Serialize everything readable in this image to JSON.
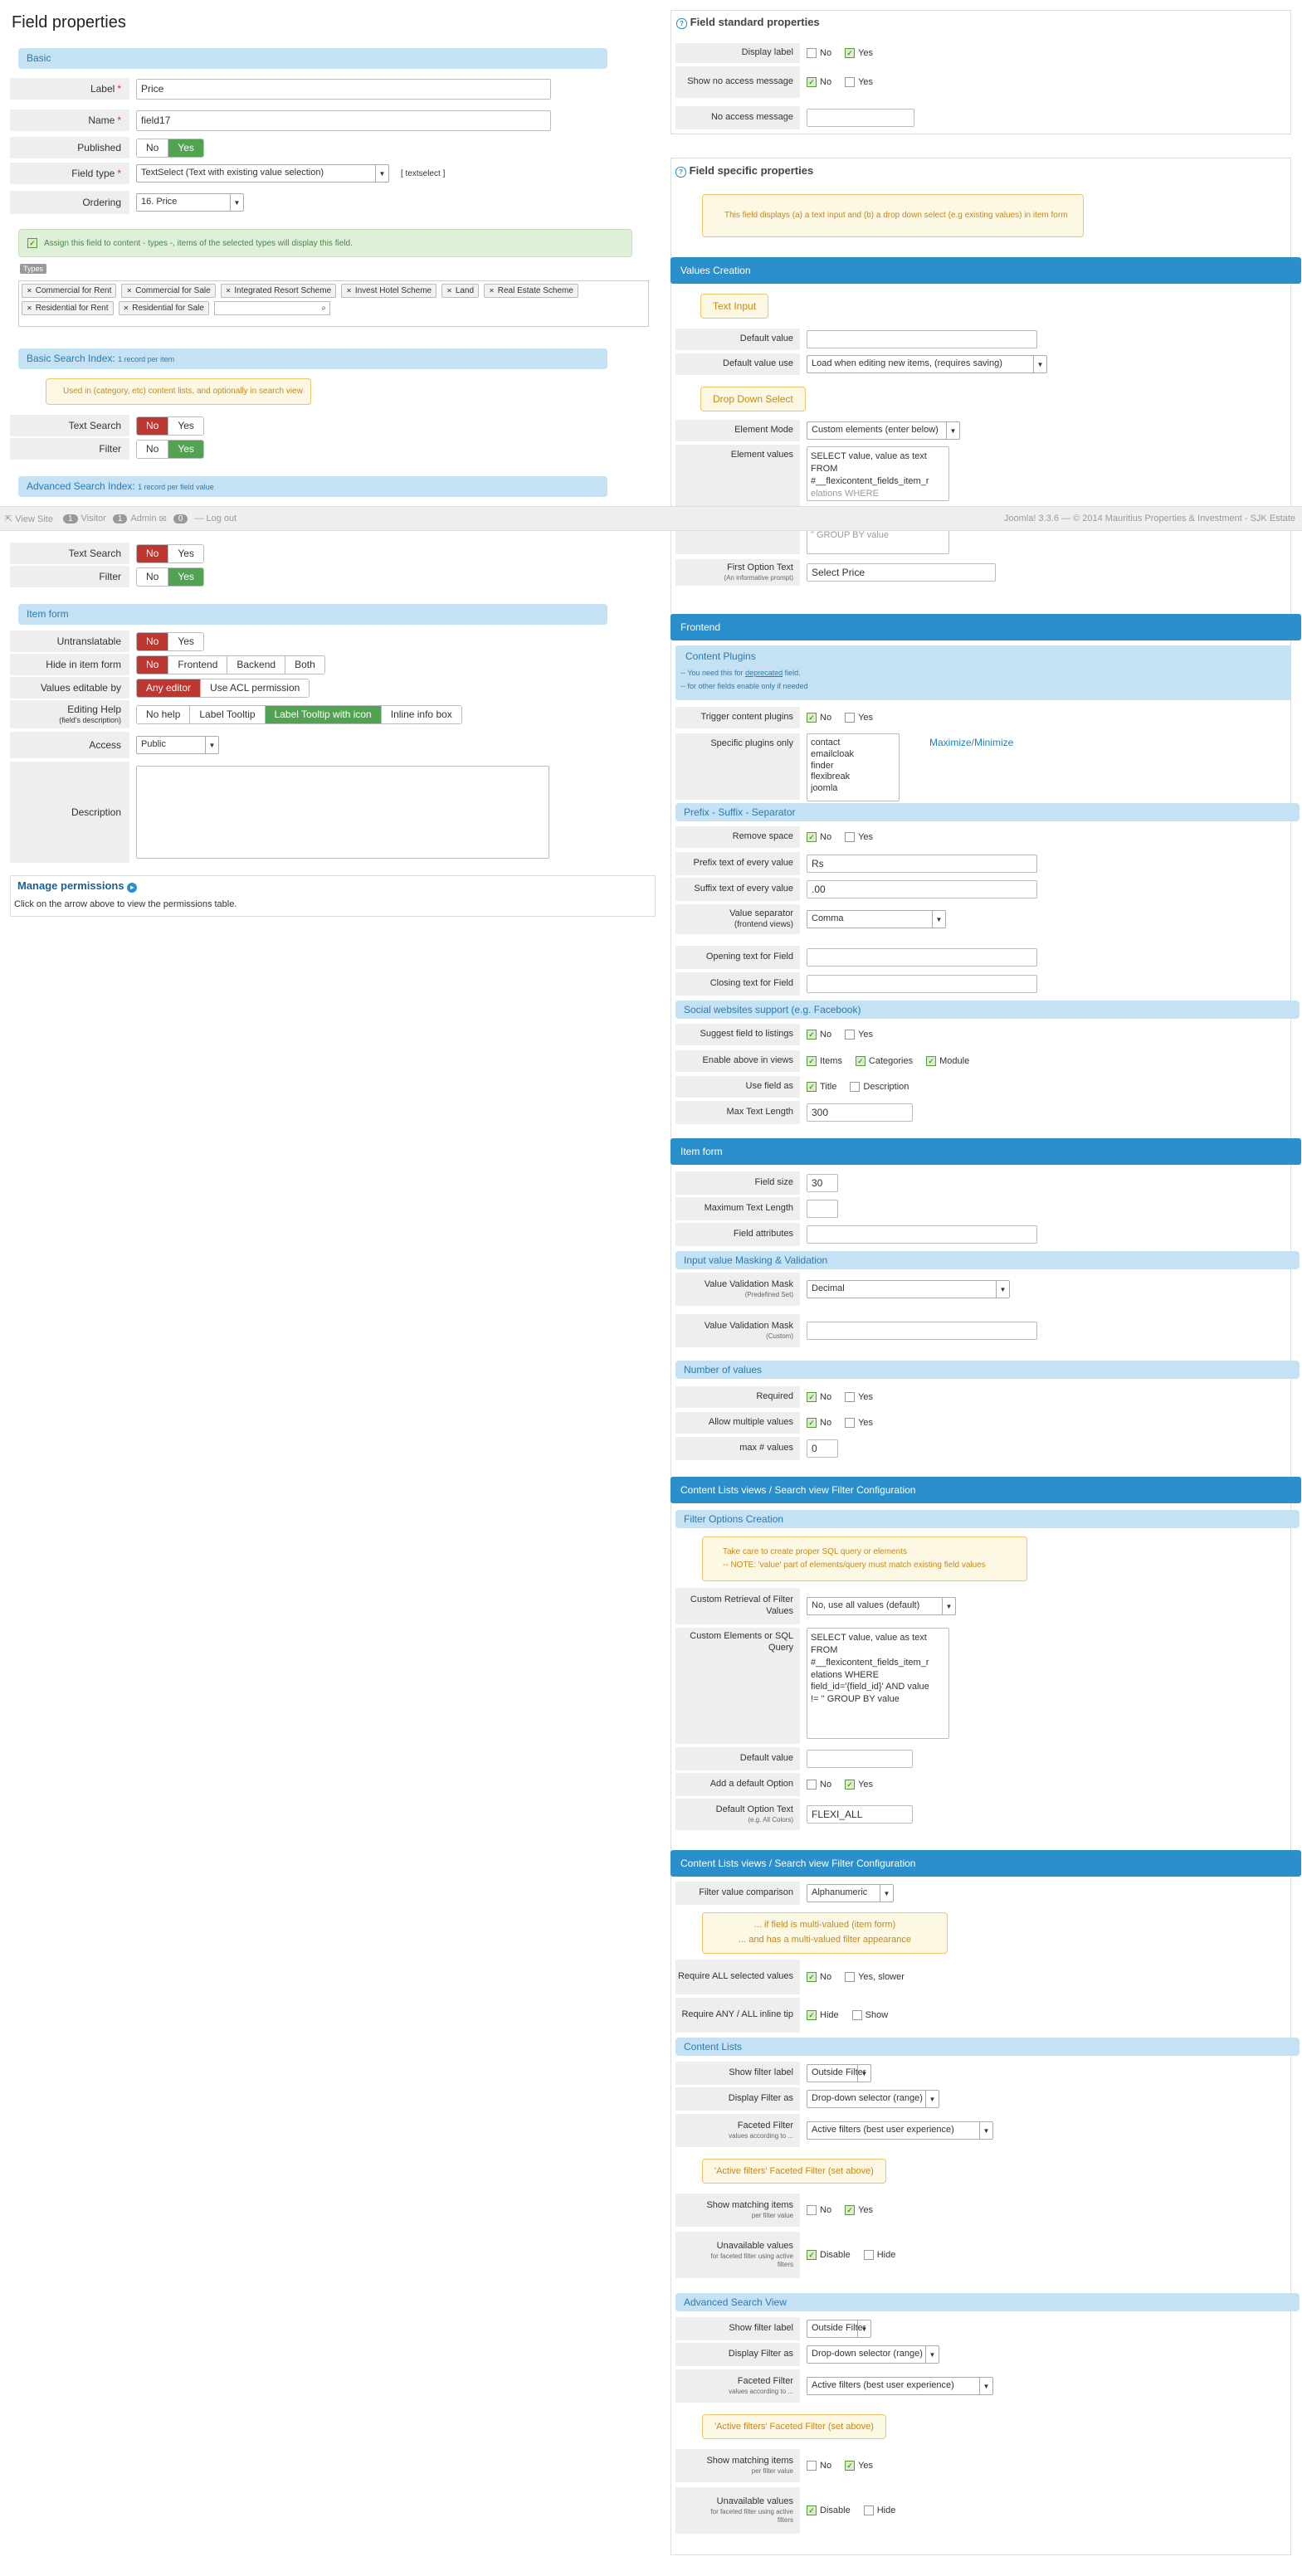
{
  "page_title": "Field properties",
  "footer_strip": {
    "view_site": "View Site",
    "visitor_count": "1",
    "visitor": "Visitor",
    "admin_count": "1",
    "admin": "Admin",
    "msg_count": "0",
    "logout": "Log out",
    "copyright": "Joomla! 3.3.6 — © 2014 Mauritius Properties & Investment - SJK Estate"
  },
  "basic": {
    "header": "Basic",
    "label": {
      "label": "Label",
      "value": "Price"
    },
    "name": {
      "label": "Name",
      "value": "field17"
    },
    "published": {
      "label": "Published",
      "no": "No",
      "yes": "Yes"
    },
    "field_type": {
      "label": "Field type",
      "value": "TextSelect (Text with existing value selection)",
      "code": "[ textselect ]"
    },
    "ordering": {
      "label": "Ordering",
      "value": "16. Price"
    },
    "assign_msg": "Assign this field to content - types -, items of the selected types will display this field.",
    "types_label": "Types",
    "types": [
      "Commercial for Rent",
      "Commercial for Sale",
      "Integrated Resort Scheme",
      "Invest Hotel Scheme",
      "Land",
      "Real Estate Scheme",
      "Residential for Rent",
      "Residential for Sale"
    ]
  },
  "basic_search": {
    "header": "Basic Search Index:",
    "header_note": "1 record per item",
    "note": "Used in (category, etc) content lists, and optionally in search view",
    "text_search": {
      "label": "Text Search",
      "no": "No",
      "yes": "Yes"
    },
    "filter": {
      "label": "Filter",
      "no": "No",
      "yes": "Yes"
    }
  },
  "adv_search": {
    "header": "Advanced Search Index:",
    "header_note": "1 record per field value",
    "text_search": {
      "label": "Text Search",
      "no": "No",
      "yes": "Yes"
    },
    "filter": {
      "label": "Filter",
      "no": "No",
      "yes": "Yes"
    }
  },
  "item_form_left": {
    "header": "Item form",
    "untranslatable": {
      "label": "Untranslatable",
      "no": "No",
      "yes": "Yes"
    },
    "hide": {
      "label": "Hide in item form",
      "opts": [
        "No",
        "Frontend",
        "Backend",
        "Both"
      ]
    },
    "editable": {
      "label": "Values editable by",
      "opts": [
        "Any editor",
        "Use ACL permission"
      ]
    },
    "help": {
      "label": "Editing Help",
      "sublabel": "(field's description)",
      "opts": [
        "No help",
        "Label Tooltip",
        "Label Tooltip with icon",
        "Inline info box"
      ]
    },
    "access": {
      "label": "Access",
      "value": "Public"
    },
    "description": {
      "label": "Description"
    }
  },
  "permissions": {
    "title": "Manage permissions",
    "text": "Click on the arrow above to view the permissions table."
  },
  "std": {
    "header": "Field standard properties",
    "display_label": {
      "label": "Display label",
      "no": "No",
      "yes": "Yes"
    },
    "show_no_access": {
      "label": "Show no access message",
      "no": "No",
      "yes": "Yes"
    },
    "no_access_msg": {
      "label": "No access message"
    }
  },
  "spec": {
    "header": "Field specific properties",
    "note": "This field displays (a) a text input and (b) a drop down select (e.g existing values) in item form",
    "values_creation": "Values Creation",
    "text_input_btn": "Text Input",
    "default_value": {
      "label": "Default value"
    },
    "default_value_use": {
      "label": "Default value use",
      "value": "Load when editing new items, (requires saving)"
    },
    "drop_down_btn": "Drop Down Select",
    "element_mode": {
      "label": "Element Mode",
      "value": "Custom elements (enter below)"
    },
    "element_values": {
      "label": "Element values",
      "lines": [
        "SELECT value, value as text",
        "FROM",
        "#__flexicontent_fields_item_r",
        "elations WHERE",
        "\" GROUP BY value"
      ]
    },
    "first_option": {
      "label": "First Option Text",
      "sublabel": "(An informative prompt)",
      "value": "Select Price"
    }
  },
  "frontend": {
    "header": "Frontend",
    "content_plugins": "Content Plugins",
    "cp_note1": "-- You need this for",
    "cp_note_link": "deprecated",
    "cp_note1b": "field.",
    "cp_note2": "-- for other fields enable only if needed",
    "trigger": {
      "label": "Trigger content plugins",
      "no": "No",
      "yes": "Yes"
    },
    "specific": {
      "label": "Specific plugins only",
      "items": [
        "contact",
        "emailcloak",
        "finder",
        "flexibreak",
        "joomla"
      ],
      "link": "Maximize/Minimize"
    },
    "prefix_header": "Prefix - Suffix - Separator",
    "remove_space": {
      "label": "Remove space",
      "no": "No",
      "yes": "Yes"
    },
    "prefix": {
      "label": "Prefix text of every value",
      "value": "Rs"
    },
    "suffix": {
      "label": "Suffix text of every value",
      "value": ".00"
    },
    "separator": {
      "label": "Value separator",
      "sublabel": "(frontend views)",
      "value": "Comma"
    },
    "opening": {
      "label": "Opening text for Field"
    },
    "closing": {
      "label": "Closing text for Field"
    },
    "social_header": "Social websites support (e.g. Facebook)",
    "suggest": {
      "label": "Suggest field to listings",
      "no": "No",
      "yes": "Yes"
    },
    "enable_above": {
      "label": "Enable above in views",
      "opts": [
        "Items",
        "Categories",
        "Module"
      ]
    },
    "use_field_as": {
      "label": "Use field as",
      "opts": [
        "Title",
        "Description"
      ]
    },
    "max_text": {
      "label": "Max Text Length",
      "value": "300"
    }
  },
  "item_form_right": {
    "header": "Item form",
    "field_size": {
      "label": "Field size",
      "value": "30"
    },
    "max_text": {
      "label": "Maximum Text Length",
      "value": ""
    },
    "attributes": {
      "label": "Field attributes",
      "value": ""
    },
    "masking_header": "Input value Masking & Validation",
    "mask": {
      "label": "Value Validation Mask",
      "sublabel": "(Predefined Set)",
      "value": "Decimal"
    },
    "mask_custom": {
      "label": "Value Validation Mask",
      "sublabel": "(Custom)"
    },
    "number_header": "Number of values",
    "required": {
      "label": "Required",
      "no": "No",
      "yes": "Yes"
    },
    "multiple": {
      "label": "Allow multiple values",
      "no": "No",
      "yes": "Yes"
    },
    "max_values": {
      "label": "max # values",
      "value": "0"
    }
  },
  "filter1": {
    "header": "Content Lists views / Search view Filter Configuration",
    "options_header": "Filter Options Creation",
    "warn1": "Take care to create proper SQL query or elements",
    "warn2": "-- NOTE: 'value' part of elements/query must match existing field values",
    "custom_retrieval": {
      "label": "Custom Retrieval of Filter Values",
      "value": "No, use all values (default)"
    },
    "custom_sql": {
      "label": "Custom Elements or SQL Query",
      "lines": [
        "SELECT value, value as text",
        "FROM",
        "#__flexicontent_fields_item_r",
        "elations WHERE",
        "field_id='{field_id}' AND value",
        "!= '' GROUP BY value"
      ]
    },
    "default_value": {
      "label": "Default value",
      "value": ""
    },
    "add_default": {
      "label": "Add a default Option",
      "no": "No",
      "yes": "Yes"
    },
    "default_text": {
      "label": "Default Option Text",
      "sublabel": "(e.g. All Colors)",
      "value": "FLEXI_ALL"
    }
  },
  "filter2": {
    "header": "Content Lists views / Search view Filter Configuration",
    "comparison": {
      "label": "Filter value comparison",
      "value": "Alphanumeric"
    },
    "warn1": "... if field is multi-valued (item form)",
    "warn2": "... and has a multi-valued filter appearance",
    "require_all": {
      "label": "Require ALL selected values",
      "no": "No",
      "yes": "Yes, slower"
    },
    "require_any": {
      "label": "Require ANY / ALL inline tip",
      "hide": "Hide",
      "show": "Show"
    },
    "content_lists": "Content Lists",
    "cl_show_label": {
      "label": "Show filter label",
      "value": "Outside Filter"
    },
    "cl_display": {
      "label": "Display Filter as",
      "value": "Drop-down selector (range)"
    },
    "cl_faceted": {
      "label": "Faceted Filter",
      "sublabel": "values according to ...",
      "value": "Active filters (best user experience)"
    },
    "cl_active_btn": "'Active filters' Faceted Filter (set above)",
    "cl_show_matching": {
      "label": "Show matching items",
      "sublabel": "per filter value",
      "no": "No",
      "yes": "Yes"
    },
    "cl_unavailable": {
      "label": "Unavailable values",
      "sublabel": "for faceted filter using active filters",
      "disable": "Disable",
      "hide": "Hide"
    },
    "advanced": "Advanced Search View",
    "as_show_label": {
      "label": "Show filter label",
      "value": "Outside Filter"
    },
    "as_display": {
      "label": "Display Filter as",
      "value": "Drop-down selector (range)"
    },
    "as_faceted": {
      "label": "Faceted Filter",
      "sublabel": "values according to ...",
      "value": "Active filters (best user experience)"
    },
    "as_active_btn": "'Active filters' Faceted Filter (set above)",
    "as_show_matching": {
      "label": "Show matching items",
      "sublabel": "per filter value",
      "no": "No",
      "yes": "Yes"
    },
    "as_unavailable": {
      "label": "Unavailable values",
      "sublabel": "for faceted filter using active filters",
      "disable": "Disable",
      "hide": "Hide"
    }
  }
}
